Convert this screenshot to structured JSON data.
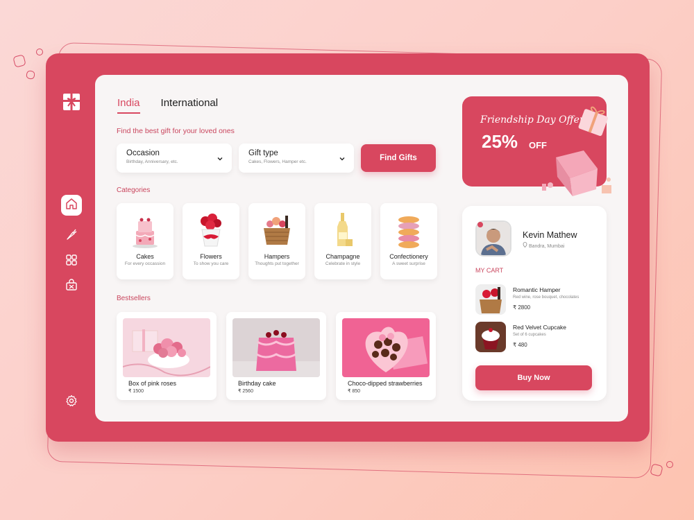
{
  "tabs": [
    {
      "label": "India",
      "active": true
    },
    {
      "label": "International",
      "active": false
    }
  ],
  "search": {
    "subtitle": "Find the best gift for your loved ones",
    "occasion_label": "Occasion",
    "occasion_hint": "Birthday, Anniversary, etc.",
    "gift_type_label": "Gift type",
    "gift_type_hint": "Cakes, Flowers, Hamper etc.",
    "find_button": "Find Gifts"
  },
  "categories_title": "Categories",
  "categories": [
    {
      "name": "Cakes",
      "desc": "For every occassion",
      "icon": "cake-icon"
    },
    {
      "name": "Flowers",
      "desc": "To show you care",
      "icon": "flowers-icon"
    },
    {
      "name": "Hampers",
      "desc": "Thoughts put together",
      "icon": "hamper-icon"
    },
    {
      "name": "Champagne",
      "desc": "Celebrate in style",
      "icon": "champagne-icon"
    },
    {
      "name": "Confectionery",
      "desc": "A sweet surprise",
      "icon": "donut-icon"
    }
  ],
  "bestsellers_title": "Bestsellers",
  "bestsellers": [
    {
      "name": "Box of pink roses",
      "price": "₹ 1500"
    },
    {
      "name": "Birthday cake",
      "price": "₹ 2560"
    },
    {
      "name": "Choco-dipped strawberries",
      "price": "₹ 850"
    }
  ],
  "offer": {
    "title": "Friendship Day Offer",
    "percent": "25%",
    "off": "OFF"
  },
  "user": {
    "name": "Kevin Mathew",
    "location": "Bandra, Mumbai"
  },
  "cart": {
    "title": "MY CART",
    "items": [
      {
        "name": "Romantic Hamper",
        "desc": "Red wine, rose bouquet, chocolates",
        "price": "₹ 2800"
      },
      {
        "name": "Red Velvet Cupcake",
        "desc": "Set of 6 cupcakes",
        "price": "₹ 480"
      }
    ],
    "buy_button": "Buy Now"
  },
  "nav": [
    "home-icon",
    "carrot-icon",
    "grid-icon",
    "gift-bag-icon",
    "settings-icon"
  ],
  "colors": {
    "accent": "#d8475f",
    "panel": "#f8f5f5"
  }
}
